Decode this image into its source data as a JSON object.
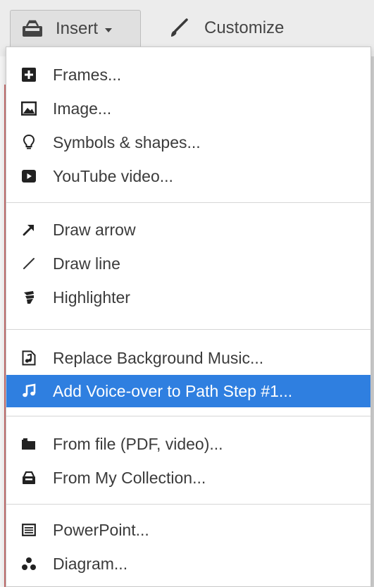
{
  "toolbar": {
    "insert_label": "Insert",
    "insert_icon": "insert-box-icon",
    "customize_label": "Customize",
    "customize_icon": "brush-icon"
  },
  "menu": {
    "groups": [
      [
        {
          "label": "Frames...",
          "icon": "plus-square-icon"
        },
        {
          "label": "Image...",
          "icon": "image-icon"
        },
        {
          "label": "Symbols & shapes...",
          "icon": "lightbulb-icon"
        },
        {
          "label": "YouTube video...",
          "icon": "play-icon"
        }
      ],
      [
        {
          "label": "Draw arrow",
          "icon": "arrow-icon"
        },
        {
          "label": "Draw line",
          "icon": "line-icon"
        },
        {
          "label": "Highlighter",
          "icon": "highlighter-icon"
        }
      ],
      [
        {
          "label": "Replace Background Music...",
          "icon": "music-file-icon"
        },
        {
          "label": "Add Voice-over to Path Step #1...",
          "icon": "music-note-icon",
          "selected": true
        }
      ],
      [
        {
          "label": "From file (PDF, video)...",
          "icon": "folder-icon"
        },
        {
          "label": "From My Collection...",
          "icon": "collection-icon"
        }
      ],
      [
        {
          "label": "PowerPoint...",
          "icon": "powerpoint-icon"
        },
        {
          "label": "Diagram...",
          "icon": "diagram-icon"
        }
      ]
    ]
  },
  "colors": {
    "selection": "#2f7fe0",
    "text": "#3b3b3b",
    "divider": "#d6d6d6"
  }
}
